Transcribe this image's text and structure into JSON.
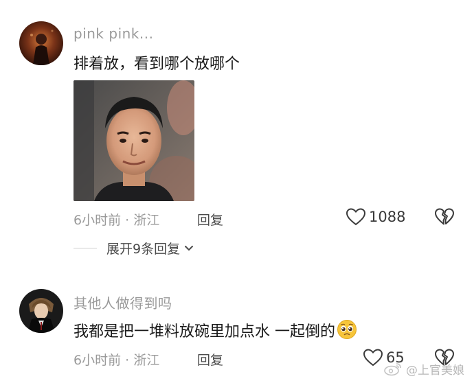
{
  "comments": [
    {
      "username": "pink pink...",
      "text": "排着放，看到哪个放哪个",
      "time_location": "6小时前 · 浙江",
      "reply_label": "回复",
      "like_count": "1088",
      "has_image": true
    },
    {
      "username": "其他人做得到吗",
      "text": "我都是把一堆料放碗里加点水 一起倒的",
      "emoji": "pleading-face",
      "time_location": "6小时前 · 浙江",
      "reply_label": "回复",
      "like_count": "65"
    }
  ],
  "expand_replies": {
    "label": "展开9条回复"
  },
  "watermark": {
    "text": "@上官美娘"
  },
  "icons": {
    "like": "heart-outline-icon",
    "dislike": "broken-heart-icon",
    "expand": "chevron-down-icon"
  }
}
